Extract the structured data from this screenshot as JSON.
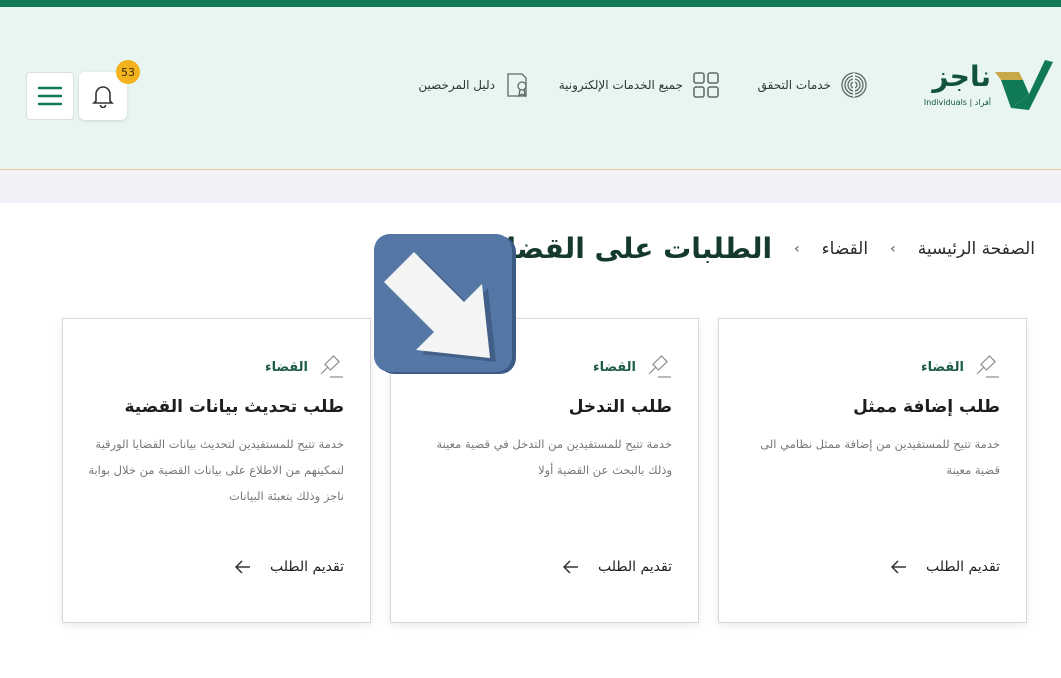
{
  "header": {
    "logo": {
      "name": "ناجز",
      "sub": "Individuals | أفراد"
    },
    "nav": [
      {
        "label": "خدمات التحقق",
        "icon": "fingerprint-icon"
      },
      {
        "label": "جميع الخدمات الإلكترونية",
        "icon": "grid-icon"
      },
      {
        "label": "دليل المرخصين",
        "icon": "certificate-icon"
      }
    ],
    "notifications_count": "53"
  },
  "breadcrumb": {
    "home": "الصفحة الرئيسية",
    "section": "القضاء",
    "sep": "›",
    "current": "الطلبات على القضايا"
  },
  "cards": [
    {
      "category": "القضاء",
      "title": "طلب إضافة ممثل",
      "description": "خدمة تتيح للمستفيدين من إضافة ممثل نظامي الى قضية معينة",
      "action": "تقديم الطلب"
    },
    {
      "category": "القضاء",
      "title": "طلب التدخل",
      "description": "خدمة تتيح للمستفيدين من التدخل في قضية معينة وذلك بالبحث عن القضية أولا",
      "action": "تقديم الطلب"
    },
    {
      "category": "القضاء",
      "title": "طلب تحديث بيانات القضية",
      "description": "خدمة تتيح للمستفيدين لتحديث بيانات القضايا الورقية لتمكينهم من الاطلاع على بيانات القضية من خلال بوابة ناجز وذلك بتعبئة البيانات",
      "action": "تقديم الطلب"
    }
  ],
  "colors": {
    "brand_green": "#0f7a55",
    "dark_green": "#11533f",
    "accent_gold": "#c9a84a",
    "badge_yellow": "#f2b31c",
    "header_bg": "#e8f5f1"
  }
}
